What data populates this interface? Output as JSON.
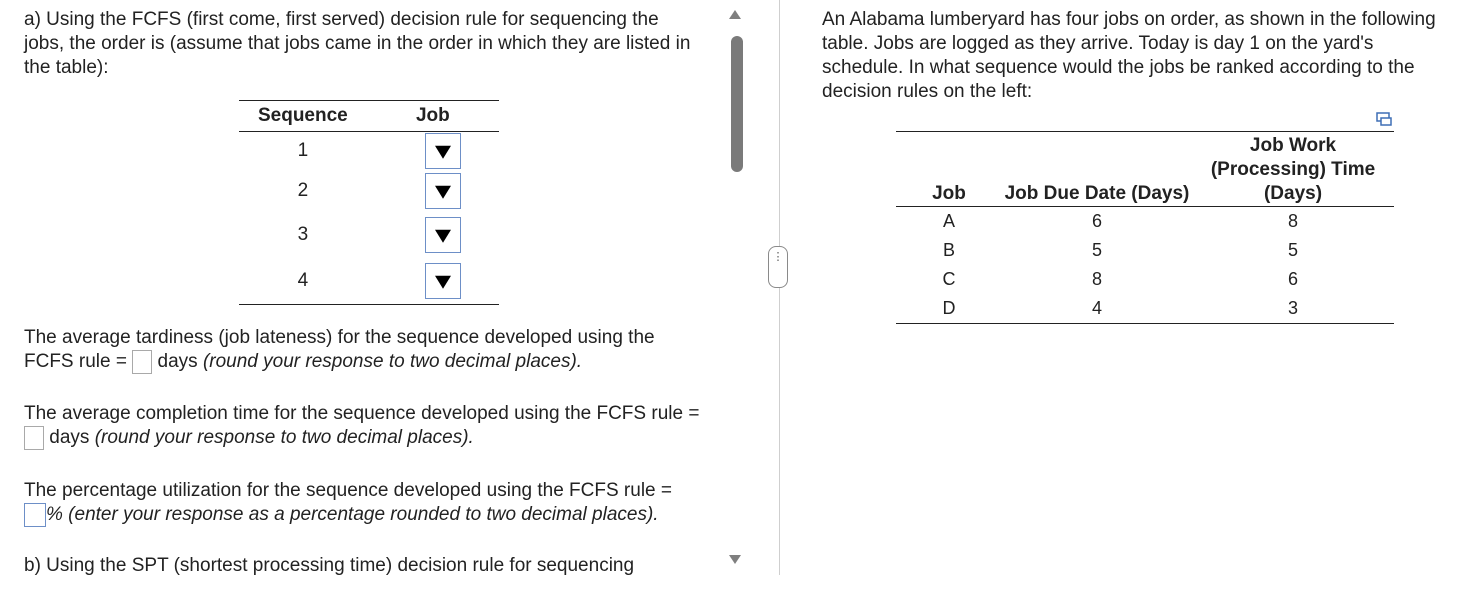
{
  "left": {
    "intro": "a) Using the FCFS (first come, first served) decision rule for sequencing the jobs, the order is (assume that jobs came in the order in which they are listed in the table):",
    "table": {
      "headers": [
        "Sequence",
        "Job"
      ],
      "rows": [
        "1",
        "2",
        "3",
        "4"
      ]
    },
    "q_tardiness": {
      "pre": "The average tardiness (job lateness) for the sequence developed using the FCFS rule =",
      "unit": "days",
      "note": "(round your response to two decimal places)."
    },
    "q_completion": {
      "pre": "The average completion time for the sequence developed using the FCFS rule =",
      "unit": "days",
      "note": "(round your response to two decimal places)."
    },
    "q_utilization": {
      "pre": "The percentage utilization for the sequence developed using the FCFS rule =",
      "note": "% (enter your response as a percentage rounded to two decimal places)."
    },
    "part_b": "b) Using the SPT (shortest processing time) decision rule for sequencing"
  },
  "right": {
    "intro": "An Alabama lumberyard has four jobs on order, as shown in the following table. Jobs are logged as they arrive. Today is day 1 on the yard's schedule. In what sequence would the jobs be ranked according to the decision rules on the left:",
    "table": {
      "headers": [
        "Job",
        "Job Due Date (Days)",
        "Job Work (Processing) Time (Days)"
      ],
      "rows": [
        {
          "job": "A",
          "due": "6",
          "work": "8"
        },
        {
          "job": "B",
          "due": "5",
          "work": "5"
        },
        {
          "job": "C",
          "due": "8",
          "work": "6"
        },
        {
          "job": "D",
          "due": "4",
          "work": "3"
        }
      ]
    }
  },
  "icons": {
    "copy": "copy-table-icon",
    "splitter": "ellipsis-icon"
  }
}
